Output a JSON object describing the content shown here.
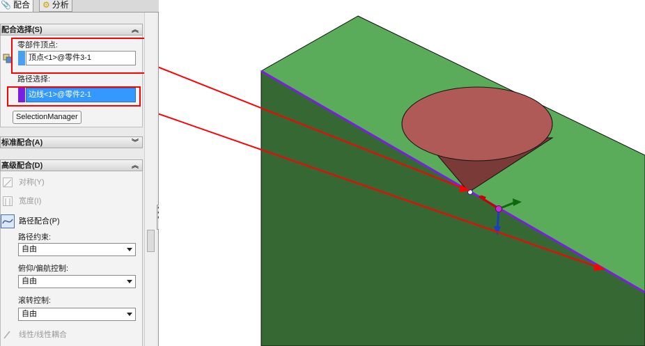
{
  "tabs": [
    {
      "label": "配合",
      "icon": "paperclip-icon"
    },
    {
      "label": "分析",
      "icon": "analysis-icon"
    }
  ],
  "mate_selections": {
    "title": "配合选择(S)",
    "vertex_label": "零部件顶点:",
    "vertex_value": "顶点<1>@零件3-1",
    "path_label": "路径选择:",
    "path_value": "边线<1>@零件2-1",
    "selection_manager_label": "SelectionManager"
  },
  "standard_mates": {
    "title": "标准配合(A)"
  },
  "advanced_mates": {
    "title": "高级配合(D)",
    "options": [
      {
        "label": "对称(Y)",
        "icon": "symmetric-icon",
        "enabled": false
      },
      {
        "label": "宽度(I)",
        "icon": "width-icon",
        "enabled": false
      },
      {
        "label": "路径配合(P)",
        "icon": "path-mate-icon",
        "enabled": true,
        "selected": true
      }
    ],
    "path_constraint_label": "路径约束:",
    "path_constraint_value": "自由",
    "pitch_yaw_label": "俯仰/偏航控制:",
    "pitch_yaw_value": "自由",
    "roll_label": "滚转控制:",
    "roll_value": "自由",
    "linear_coupler_label": "线性/线性耦合"
  },
  "colors": {
    "annotation_red": "#ff0000",
    "selection_blue": "#3399ff",
    "path_edge_purple": "#7a1fe0",
    "top_face_green": "#5aab5a",
    "front_face_green": "#356833",
    "cone_top": "#b05a58",
    "cone_side": "#7a3a38"
  }
}
